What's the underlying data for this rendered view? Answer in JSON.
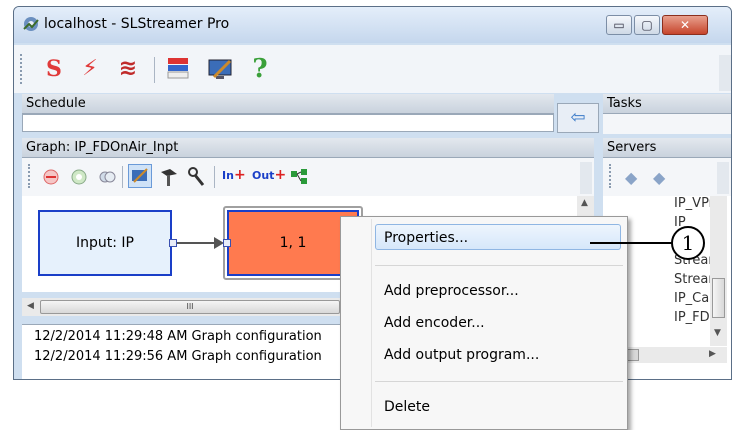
{
  "window": {
    "title": "localhost - SLStreamer Pro",
    "min_glyph": "▭",
    "max_glyph": "▢",
    "close_glyph": "✕"
  },
  "toolbar": {
    "icons": [
      "s-logo-icon",
      "lightning-icon",
      "waves-icon",
      "flags-icon",
      "monitor-edit-icon",
      "help-icon"
    ],
    "s_glyph": "S",
    "bolt_glyph": "⚡",
    "wave_glyph": "≋",
    "help_glyph": "?"
  },
  "schedule": {
    "header": "Schedule",
    "arrow_glyph": "⇦"
  },
  "tasks": {
    "header": "Tasks"
  },
  "servers": {
    "header": "Servers",
    "items": [
      "IP_VPr",
      "IP_",
      "S",
      "Stream",
      "Stream",
      "IP_Cap",
      "IP_FDC"
    ]
  },
  "graph": {
    "header": "Graph: IP_FDOnAir_Inpt",
    "in_label": "In",
    "out_label": "Out",
    "input_node": "Input: IP",
    "process_node": "1, 1",
    "hscroll_thumb": "III"
  },
  "log": {
    "lines": [
      "12/2/2014 11:29:48 AM Graph configuration",
      "12/2/2014 11:29:56 AM Graph configuration"
    ]
  },
  "context_menu": {
    "items": [
      "Properties...",
      "Add preprocessor...",
      "Add encoder...",
      "Add output program...",
      "Delete"
    ]
  },
  "callout": {
    "number": "1"
  },
  "colors": {
    "accent": "#ff7a4f",
    "node_border": "#1a3fc8",
    "input_fill": "#e6f1fc"
  }
}
